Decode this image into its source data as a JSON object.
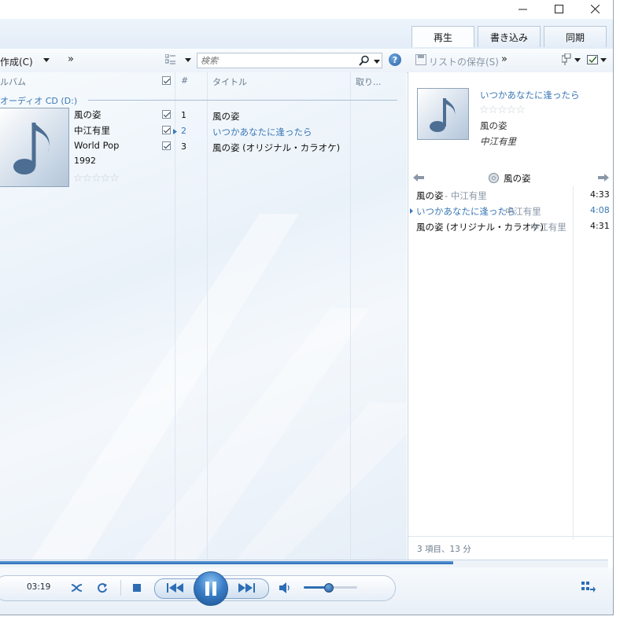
{
  "window": {
    "caption_minimize": "—",
    "caption_maximize": "☐",
    "caption_close": "✕"
  },
  "tabs": [
    {
      "label": "再生",
      "active": true
    },
    {
      "label": "書き込み",
      "active": false
    },
    {
      "label": "同期",
      "active": false
    }
  ],
  "toolbar": {
    "create_label": "作成(C)",
    "more_label": "»",
    "search_placeholder": "検索",
    "help_label": "?",
    "save_list_label": "リストの保存(S)",
    "right_more_label": "»"
  },
  "library": {
    "columns": {
      "album": "ルバム",
      "number": "#",
      "title": "タイトル",
      "rip": "取り..."
    },
    "group_header": "オーディオ CD (D:)",
    "album_info": {
      "title": "風の姿",
      "artist": "中江有里",
      "genre": "World Pop",
      "year": "1992"
    },
    "tracks": [
      {
        "number": "1",
        "title": "風の姿",
        "playing": false
      },
      {
        "number": "2",
        "title": "いつかあなたに逢ったら",
        "playing": true
      },
      {
        "number": "3",
        "title": "風の姿 (オリジナル・カラオケ)",
        "playing": false
      }
    ]
  },
  "now_playing": {
    "title": "いつかあなたに逢ったら",
    "album": "風の姿",
    "artist": "中江有里",
    "list_title": "風の姿",
    "items": [
      {
        "title": "風の姿",
        "artist": "中江有里",
        "duration": "4:33",
        "playing": false
      },
      {
        "title": "いつかあなたに逢ったら",
        "artist": "中江有里",
        "duration": "4:08",
        "playing": true
      },
      {
        "title": "風の姿 (オリジナル・カラオケ)",
        "artist": "中江有里",
        "duration": "4:31",
        "playing": false
      }
    ],
    "summary": "3 項目、13 分",
    "separator": " - "
  },
  "player": {
    "elapsed": "03:19",
    "volume": 0.45
  },
  "colors": {
    "accent": "#2d6db4",
    "playing_text": "#3a78b6"
  }
}
